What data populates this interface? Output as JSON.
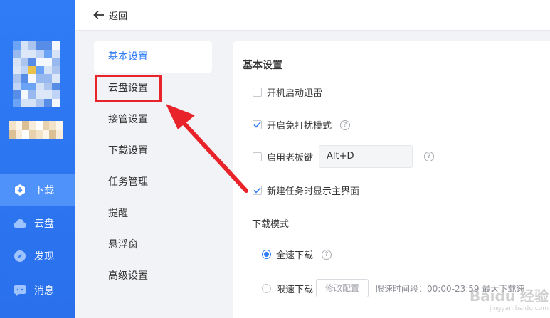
{
  "header": {
    "back_label": "返回"
  },
  "sidebar": {
    "items": [
      {
        "label": "下载",
        "icon": "download-icon",
        "active": true
      },
      {
        "label": "云盘",
        "icon": "cloud-icon",
        "active": false
      },
      {
        "label": "发现",
        "icon": "compass-icon",
        "active": false
      },
      {
        "label": "消息",
        "icon": "message-icon",
        "active": false
      }
    ]
  },
  "settings_menu": [
    "基本设置",
    "云盘设置",
    "接管设置",
    "下载设置",
    "任务管理",
    "提醒",
    "悬浮窗",
    "高级设置"
  ],
  "panel": {
    "title": "基本设置",
    "options": [
      {
        "label": "开机启动迅雷",
        "checked": false
      },
      {
        "label": "开启免打扰模式",
        "checked": true
      },
      {
        "label": "启用老板键",
        "checked": false,
        "hotkey": "Alt+D"
      },
      {
        "label": "新建任务时显示主界面",
        "checked": true
      }
    ],
    "download_mode": {
      "label": "下载模式",
      "full_speed": "全速下载",
      "limited": "限速下载",
      "config_button": "修改配置",
      "limit_note": "限速时间段：00:00-23:59  最大下载速"
    }
  },
  "watermark": {
    "text": "Baidu 经验",
    "sub": "jingyan.baidu.com"
  },
  "colors": {
    "accent": "#2f7cf6",
    "annotation": "#e8232a",
    "sidebar": "#2f7cf6"
  }
}
